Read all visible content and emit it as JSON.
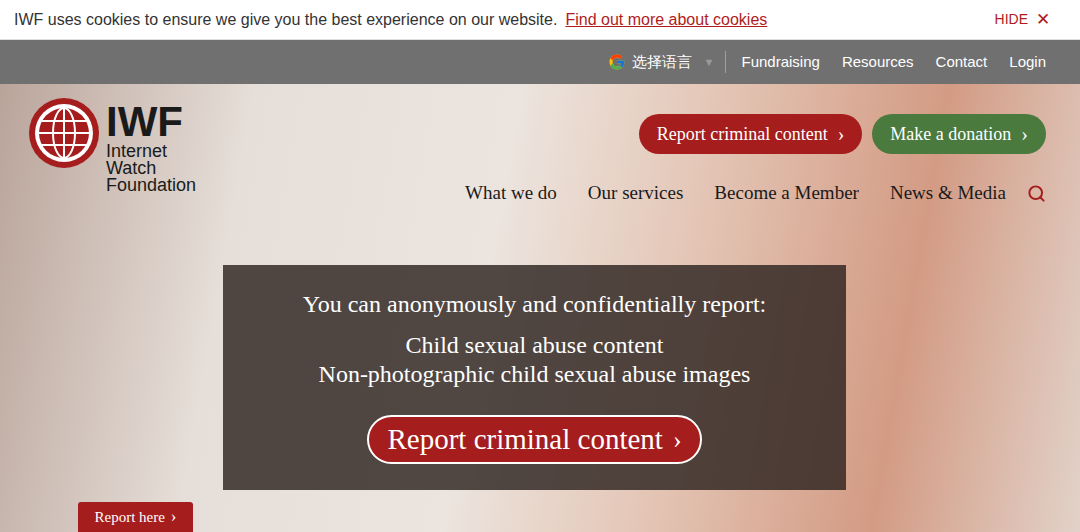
{
  "cookie_bar": {
    "message": "IWF uses cookies to ensure we give you the best experience on our website.",
    "link": "Find out more about cookies",
    "hide": "HIDE",
    "close": "✕"
  },
  "top_bar": {
    "language": {
      "label": "选择语言",
      "caret": "▼"
    },
    "links": [
      "Fundraising",
      "Resources",
      "Contact",
      "Login"
    ]
  },
  "logo": {
    "abbr": "IWF",
    "lines": [
      "Internet",
      "Watch",
      "Foundation"
    ]
  },
  "header_buttons": [
    {
      "label": "Report criminal content",
      "chevron": "›",
      "color": "#a51d1d"
    },
    {
      "label": "Make a donation",
      "chevron": "›",
      "color": "#4a7a3d"
    }
  ],
  "nav": {
    "items": [
      "What we do",
      "Our services",
      "Become a Member",
      "News & Media"
    ]
  },
  "hero": {
    "intro": "You can anonymously and confidentially report:",
    "items": [
      "Child sexual abuse content",
      "Non-photographic child sexual abuse images"
    ],
    "button": {
      "label": "Report criminal content",
      "chevron": "›"
    }
  },
  "report_tab": {
    "label": "Report here",
    "chevron": "›"
  }
}
